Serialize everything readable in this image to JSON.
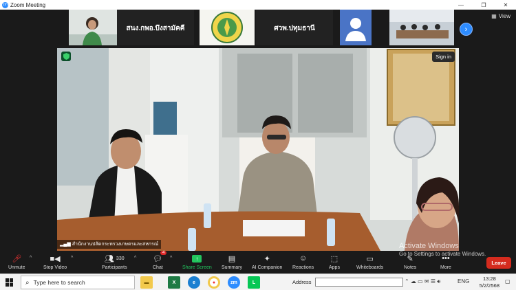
{
  "window": {
    "title": "Zoom Meeting"
  },
  "gallery": {
    "thumbnails": [
      {
        "label": ""
      },
      {
        "label": "สนง.กพอ.บึงสามัคคี"
      },
      {
        "label": ""
      },
      {
        "label": "ศวพ.ปทุมธานี"
      },
      {
        "label": ""
      },
      {
        "label": ""
      }
    ],
    "view_label": "View"
  },
  "video": {
    "signin_label": "Sign in",
    "participant_name": "สำนักงานปลัดกระทรวงเกษตรและสหกรณ์"
  },
  "watermark": {
    "title": "Activate Windows",
    "subtitle": "Go to Settings to activate Windows."
  },
  "toolbar": {
    "unmute": "Unmute",
    "stop_video": "Stop Video",
    "participants": "Participants",
    "participants_count": "330",
    "chat": "Chat",
    "chat_badge": "4",
    "share_screen": "Share Screen",
    "summary": "Summary",
    "ai_companion": "AI Companion",
    "reactions": "Reactions",
    "apps": "Apps",
    "whiteboards": "Whiteboards",
    "notes": "Notes",
    "more": "More",
    "leave": "Leave"
  },
  "taskbar": {
    "search_placeholder": "Type here to search",
    "address_label": "Address",
    "language": "ENG",
    "time": "13:28",
    "date": "5/2/2568"
  },
  "colors": {
    "accent": "#2d8cff",
    "share": "#22c55e",
    "leave": "#d52b1e"
  }
}
